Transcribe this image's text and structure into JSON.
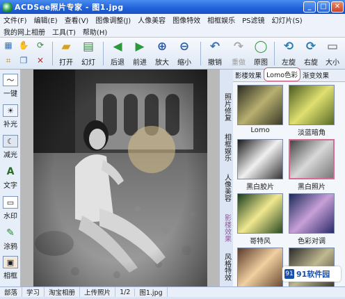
{
  "window": {
    "title": "ACDSee照片专家 - 图1.jpg",
    "minimize": "_",
    "maximize": "□",
    "close": "✕"
  },
  "menu": {
    "row1": [
      "文件(F)",
      "编辑(E)",
      "查看(V)",
      "图像调整(J)",
      "人像美容",
      "图像特效",
      "相框娱乐",
      "PS滤镜",
      "幻灯片(S)"
    ],
    "row2": [
      "我的网上相册",
      "工具(T)",
      "帮助(H)"
    ]
  },
  "toolbar": {
    "buttons": [
      {
        "label": "打开",
        "icon": "open-folder-icon",
        "glyph": "📂"
      },
      {
        "label": "幻灯",
        "icon": "slideshow-icon",
        "glyph": "▤"
      },
      {
        "label": "后退",
        "icon": "back-arrow-icon",
        "glyph": "⬅"
      },
      {
        "label": "前进",
        "icon": "forward-arrow-icon",
        "glyph": "➡"
      },
      {
        "label": "放大",
        "icon": "zoom-in-icon",
        "glyph": "🔍"
      },
      {
        "label": "缩小",
        "icon": "zoom-out-icon",
        "glyph": "🔍"
      },
      {
        "label": "撤销",
        "icon": "undo-icon",
        "glyph": "↶"
      },
      {
        "label": "重做",
        "icon": "redo-icon",
        "glyph": "↷"
      },
      {
        "label": "原图",
        "icon": "original-icon",
        "glyph": "◯"
      },
      {
        "label": "左旋",
        "icon": "rotate-left-icon",
        "glyph": "⟲"
      },
      {
        "label": "右旋",
        "icon": "rotate-right-icon",
        "glyph": "⟳"
      },
      {
        "label": "大小",
        "icon": "resize-icon",
        "glyph": "▭"
      }
    ]
  },
  "left_tools": [
    {
      "label": "一键",
      "icon": "one-click-icon"
    },
    {
      "label": "补光",
      "icon": "fill-light-icon"
    },
    {
      "label": "减光",
      "icon": "reduce-light-icon"
    },
    {
      "label": "文字",
      "icon": "text-icon"
    },
    {
      "label": "水印",
      "icon": "watermark-icon"
    },
    {
      "label": "涂鸦",
      "icon": "doodle-icon"
    },
    {
      "label": "相框",
      "icon": "frame-icon"
    }
  ],
  "side_tabs": [
    "照片修复",
    "相框娱乐",
    "人像美容",
    "影楼效果",
    "风格特效"
  ],
  "effects_panel": {
    "tabs": [
      "影楼效果",
      "Lomo色彩",
      "渐变效果"
    ],
    "active_tab": "Lomo色彩",
    "thumbnails": [
      {
        "label": "Lomo"
      },
      {
        "label": "淡蓝暗角"
      },
      {
        "label": "黑白胶片"
      },
      {
        "label": "黑白照片",
        "selected": true
      },
      {
        "label": "哥特风"
      },
      {
        "label": "色彩对调"
      },
      {
        "label": ""
      },
      {
        "label": ""
      }
    ]
  },
  "status": [
    "部落",
    "学习",
    "淘宝相册",
    "上传照片",
    "1/2",
    "图1.jpg"
  ],
  "watermark": {
    "icon": "91",
    "text": "91软件园"
  },
  "colors": {
    "titlebar": "#2060d8",
    "selected_border": "#d56d92",
    "accent": "#1a4fa8"
  }
}
